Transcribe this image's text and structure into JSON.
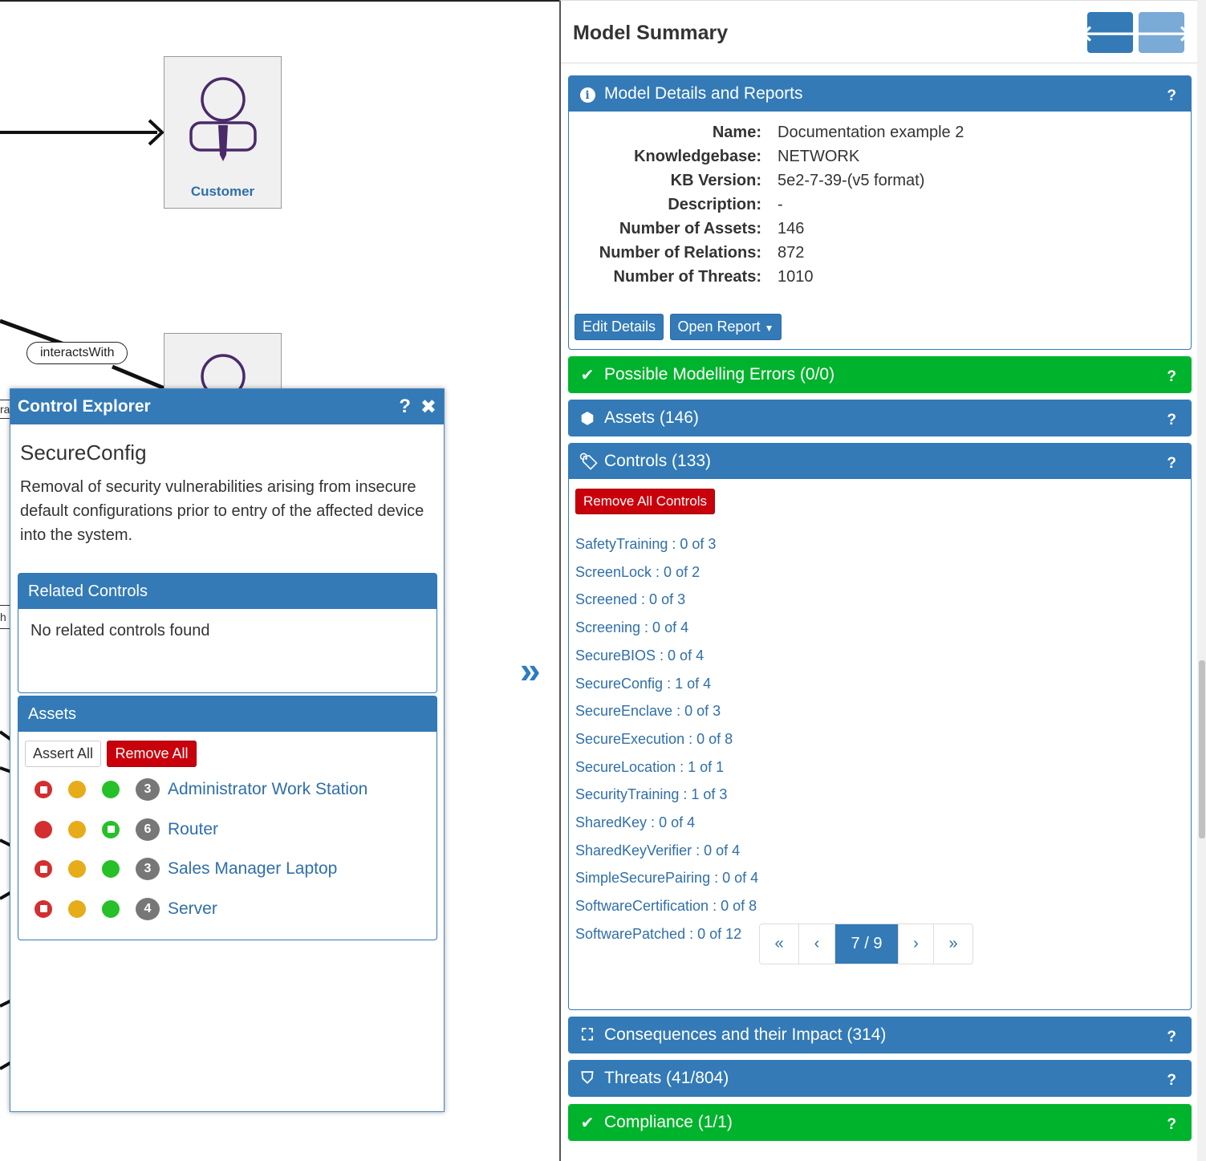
{
  "canvas": {
    "customer_label": "Customer",
    "relation_label": "interactsWith",
    "stub_a": "ra",
    "stub_b": "h"
  },
  "control_explorer": {
    "title": "Control Explorer",
    "help_icon": "?",
    "close_icon": "✖",
    "control_name": "SecureConfig",
    "description": "Removal of security vulnerabilities arising from insecure default configurations prior to entry of the affected device into the system.",
    "related_title": "Related Controls",
    "related_empty": "No related controls found",
    "assets_title": "Assets",
    "assert_all_label": "Assert All",
    "remove_all_label": "Remove All",
    "assets": [
      {
        "name": "Administrator Work Station",
        "count": "3",
        "red": "square",
        "green": "solid"
      },
      {
        "name": "Router",
        "count": "6",
        "red": "solid",
        "green": "square"
      },
      {
        "name": "Sales Manager Laptop",
        "count": "3",
        "red": "square",
        "green": "solid"
      },
      {
        "name": "Server",
        "count": "4",
        "red": "square",
        "green": "solid"
      }
    ],
    "colors": {
      "red": "#d32f2f",
      "amber": "#e6ac19",
      "green": "#26c028"
    }
  },
  "model_summary": {
    "title": "Model Summary",
    "back_icon": "arrow-left-icon",
    "forward_icon": "arrow-right-icon",
    "details_panel": {
      "title": "Model Details and Reports",
      "help": "?",
      "rows": [
        {
          "k": "Name:",
          "v": "Documentation example 2"
        },
        {
          "k": "Knowledgebase:",
          "v": "NETWORK"
        },
        {
          "k": "KB Version:",
          "v": "5e2-7-39-(v5 format)"
        },
        {
          "k": "Description:",
          "v": "-"
        },
        {
          "k": "Number of Assets:",
          "v": "146"
        },
        {
          "k": "Number of Relations:",
          "v": "872"
        },
        {
          "k": "Number of Threats:",
          "v": "1010"
        }
      ],
      "edit_label": "Edit Details",
      "report_label": "Open Report"
    },
    "errors_panel": {
      "title": "Possible Modelling Errors (0/0)",
      "help": "?"
    },
    "assets_panel": {
      "title": "Assets (146)",
      "help": "?"
    },
    "controls_panel": {
      "title": "Controls (133)",
      "help": "?",
      "remove_all_label": "Remove All Controls",
      "items": [
        "SafetyTraining : 0 of 3",
        "ScreenLock : 0 of 2",
        "Screened : 0 of 3",
        "Screening : 0 of 4",
        "SecureBIOS : 0 of 4",
        "SecureConfig : 1 of 4",
        "SecureEnclave : 0 of 3",
        "SecureExecution : 0 of 8",
        "SecureLocation : 1 of 1",
        "SecurityTraining : 1 of 3",
        "SharedKey : 0 of 4",
        "SharedKeyVerifier : 0 of 4",
        "SimpleSecurePairing : 0 of 4",
        "SoftwareCertification : 0 of 8",
        "SoftwarePatched : 0 of 12"
      ],
      "pager": {
        "first": "«",
        "prev": "‹",
        "current": "7 / 9",
        "next": "›",
        "last": "»"
      }
    },
    "consequences_panel": {
      "title": "Consequences and their Impact (314)",
      "help": "?"
    },
    "threats_panel": {
      "title": "Threats (41/804)",
      "help": "?"
    },
    "compliance_panel": {
      "title": "Compliance (1/1)",
      "help": "?"
    }
  }
}
